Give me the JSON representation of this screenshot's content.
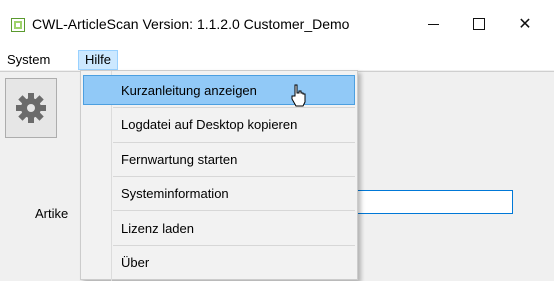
{
  "window": {
    "title": "CWL-ArticleScan  Version: 1.1.2.0  Customer_Demo",
    "minimize_glyph": "",
    "maximize_glyph": "",
    "close_glyph": "✕"
  },
  "menubar": {
    "items": [
      {
        "label": "System"
      },
      {
        "label": "Hilfe"
      }
    ]
  },
  "toolbar": {
    "settings_icon": "gear-icon"
  },
  "content": {
    "article_label": "Artike"
  },
  "dropdown": {
    "items": [
      {
        "label": "Kurzanleitung anzeigen"
      },
      {
        "label": "Logdatei auf Desktop kopieren"
      },
      {
        "label": "Fernwartung starten"
      },
      {
        "label": "Systeminformation"
      },
      {
        "label": "Lizenz laden"
      },
      {
        "label": "Über"
      }
    ]
  },
  "colors": {
    "highlight": "#91c9f7",
    "menu_open": "#cce8ff",
    "input_border": "#0078d7"
  }
}
